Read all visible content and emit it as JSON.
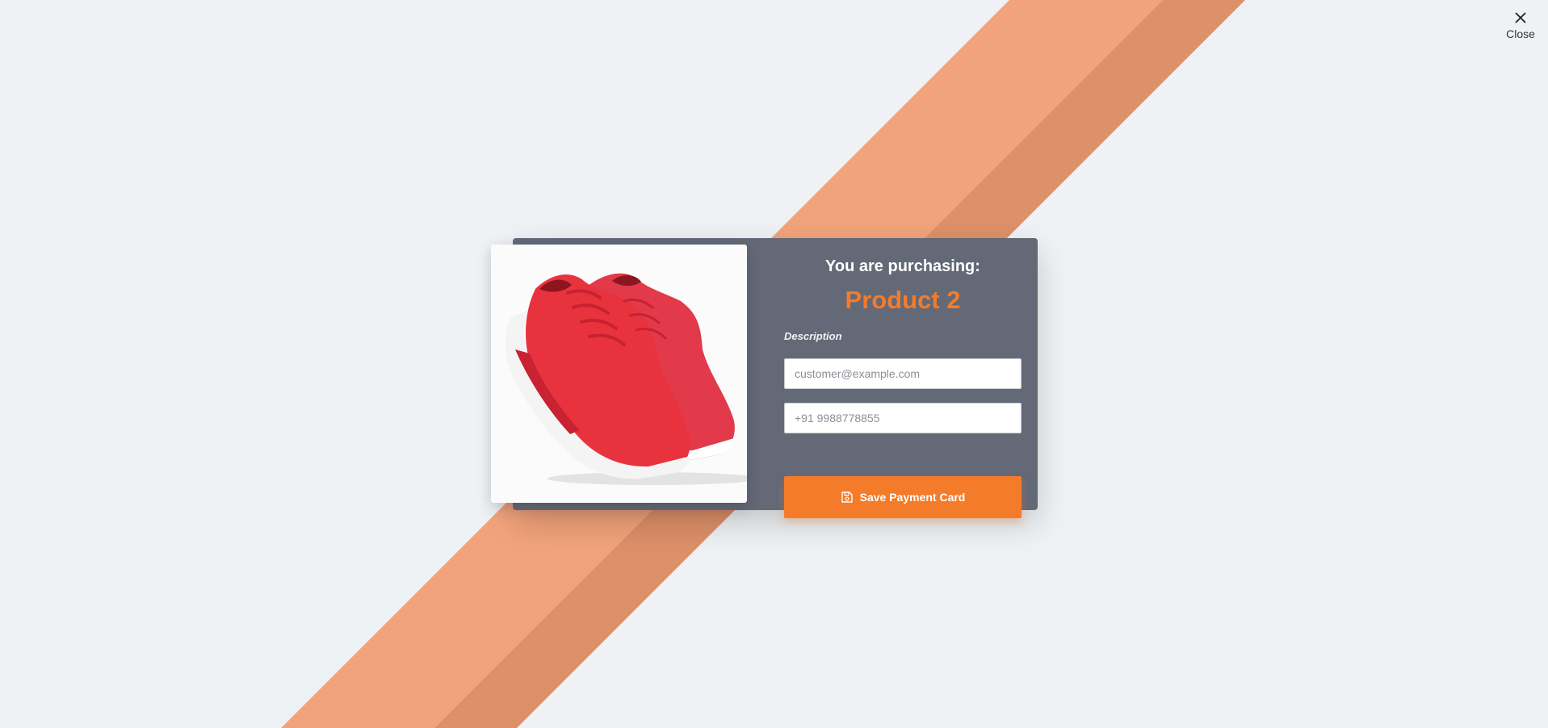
{
  "close": {
    "label": "Close",
    "icon": "close-icon"
  },
  "purchase": {
    "heading": "You are purchasing:",
    "product_name": "Product 2",
    "description_label": "Description",
    "image_icon": "red-sneakers-image"
  },
  "form": {
    "email_placeholder": "customer@example.com",
    "phone_placeholder": "+91 9988778855",
    "save_label": "Save Payment Card",
    "save_icon": "floppy-disk-icon"
  },
  "colors": {
    "background": "#eef2f5",
    "stripe_light": "#f2a37b",
    "stripe_dark": "#de9069",
    "modal": "#636977",
    "accent": "#f47b2a",
    "heading": "#ffffff"
  }
}
